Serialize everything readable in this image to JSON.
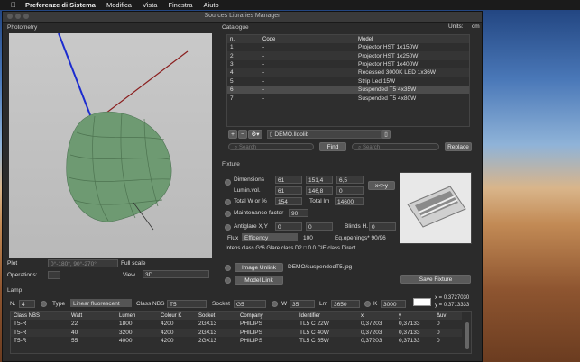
{
  "menubar": {
    "app": "Preferenze di Sistema",
    "items": [
      "Modifica",
      "Vista",
      "Finestra",
      "Aiuto"
    ]
  },
  "window": {
    "title": "Sources Libraries Manager",
    "units_label": "Units:",
    "units_value": "cm"
  },
  "photometry": {
    "label": "Photometry",
    "plot_label": "Plot",
    "plot_value": "0°-180°, 90°-270°",
    "full_scale": "Full scale",
    "operations_label": "Operations:",
    "operations_value": "-",
    "view_label": "View",
    "view_value": "3D"
  },
  "catalogue": {
    "label": "Catalogue",
    "headers": [
      "n.",
      "Code",
      "Model"
    ],
    "rows": [
      {
        "n": "1",
        "code": "-",
        "model": "Projector HST 1x150W"
      },
      {
        "n": "2",
        "code": "-",
        "model": "Projector HST 1x250W"
      },
      {
        "n": "3",
        "code": "-",
        "model": "Projector HST 1x400W"
      },
      {
        "n": "4",
        "code": "-",
        "model": "Recessed 3000K LED 1x36W"
      },
      {
        "n": "5",
        "code": "-",
        "model": "Strip Led 15W"
      },
      {
        "n": "6",
        "code": "-",
        "model": "Suspended T5  4x35W"
      },
      {
        "n": "7",
        "code": "-",
        "model": "Suspended T5  4x80W"
      }
    ],
    "library_file": "DEMO.lldolib",
    "search_placeholder": "Search",
    "find_label": "Find",
    "replace_search_placeholder": "Search",
    "replace_label": "Replace"
  },
  "fixture": {
    "label": "Fixture",
    "dimensions_label": "Dimensions",
    "dim_values": [
      "61",
      "151,4",
      "6,5"
    ],
    "swap_label": "x<>y",
    "lumin_label": "Lumin.vol.",
    "lumin_values": [
      "61",
      "146,8",
      "0"
    ],
    "total_w_label": "Total W or %",
    "total_w_value": "154",
    "total_lm_label": "Total lm",
    "total_lm_value": "14600",
    "maint_label": "Maintenance factor",
    "maint_value": "90",
    "antiglare_label": "Antiglare X,Y",
    "antiglare_values": [
      "0",
      "0"
    ],
    "blinds_label": "Blinds H.",
    "blinds_value": "0",
    "flux_label": "Flux",
    "flux_value": "Efficency",
    "flux_number": "100",
    "eq_openings": "Eq.openings* 90/96",
    "intens_class": "Intens.class G*6  Glare class D2  □ 0.0  CIE class Direct",
    "image_unlink": "Image Unlink",
    "image_file": "DEMO/suspendedT5.jpg",
    "model_link": "Model Link",
    "save_fixture": "Save Fixture"
  },
  "lamp": {
    "label": "Lamp",
    "n_label": "N.",
    "n_value": "4",
    "type_label": "Type",
    "type_value": "Linear fluorescent",
    "class_nbs_label": "Class NBS",
    "class_nbs_value": "T5",
    "socket_label": "Socket",
    "socket_value": "G5",
    "w_label": "W",
    "w_value": "35",
    "lm_label": "Lm",
    "lm_value": "3650",
    "k_label": "K",
    "k_value": "3000",
    "xy_x": "x = 0.3727030",
    "xy_y": "y = 0.3713333",
    "headers": [
      "Class NBS",
      "Watt",
      "Lumen",
      "Colour K",
      "Socket",
      "Company",
      "Identifier",
      "x",
      "y",
      "Δuv"
    ],
    "rows": [
      [
        "T5-R",
        "22",
        "1800",
        "4200",
        "2GX13",
        "PHILIPS",
        "TL5 C 22W",
        "0,37203",
        "0,37133",
        "0"
      ],
      [
        "T5-R",
        "40",
        "3200",
        "4200",
        "2GX13",
        "PHILIPS",
        "TL5 C 40W",
        "0,37203",
        "0,37133",
        "0"
      ],
      [
        "T5-R",
        "55",
        "4000",
        "4200",
        "2GX13",
        "PHILIPS",
        "TL5 C 55W",
        "0,37203",
        "0,37133",
        "0"
      ]
    ]
  }
}
